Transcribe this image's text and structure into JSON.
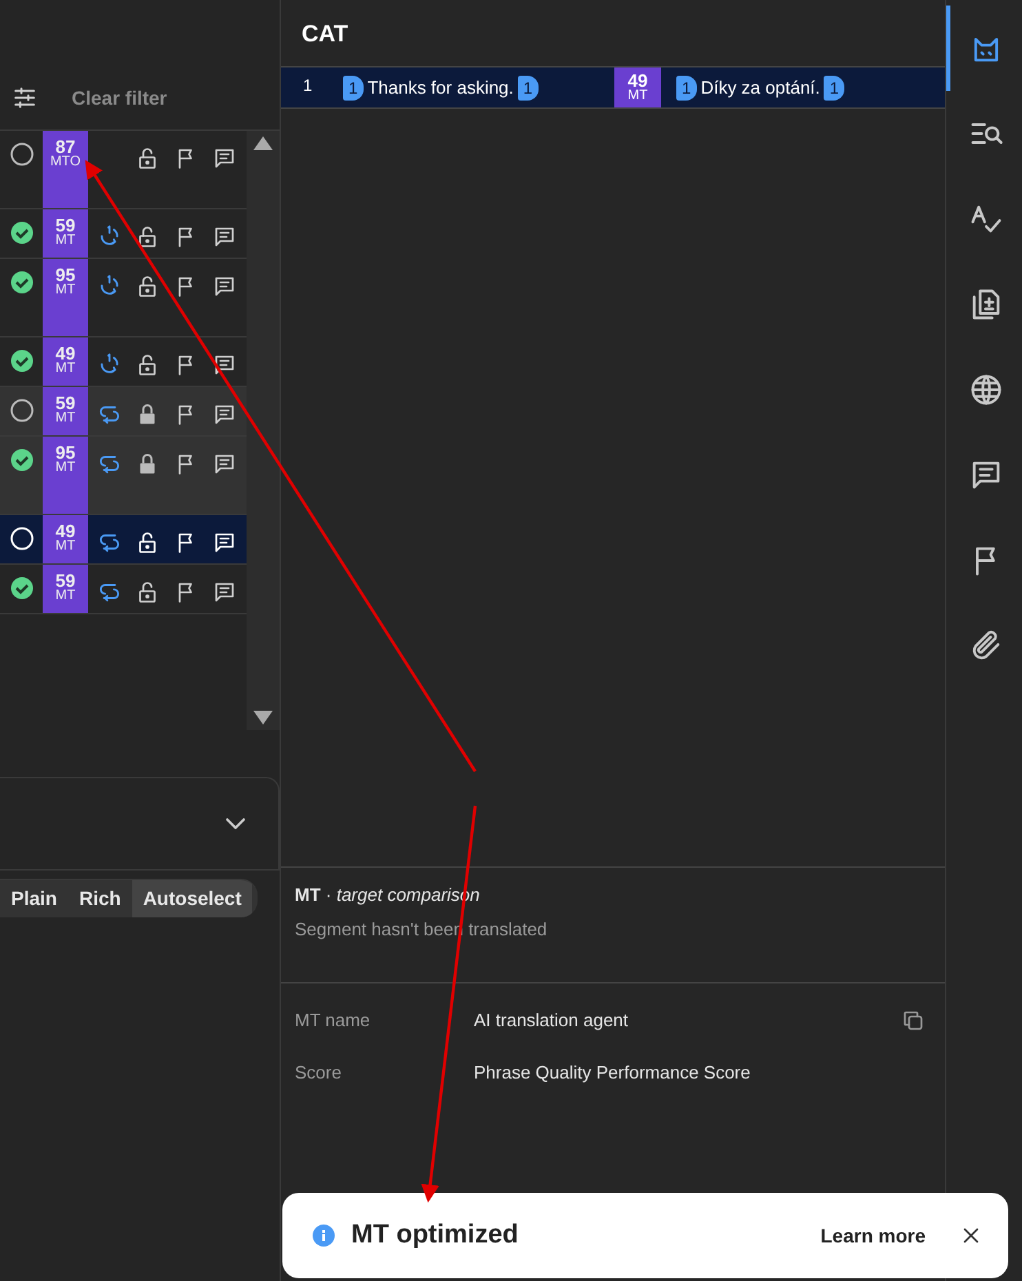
{
  "filter_bar": {
    "clear_label": "Clear filter"
  },
  "segments": [
    {
      "kind": "unique",
      "confirmed": false,
      "score": "87",
      "score_type": "MTO",
      "locked": false,
      "selected": false,
      "tall": true
    },
    {
      "kind": "first",
      "confirmed": true,
      "score": "59",
      "score_type": "MT",
      "locked": false,
      "selected": false,
      "tall": false
    },
    {
      "kind": "first",
      "confirmed": true,
      "score": "95",
      "score_type": "MT",
      "locked": false,
      "selected": false,
      "tall": true
    },
    {
      "kind": "first",
      "confirmed": true,
      "score": "49",
      "score_type": "MT",
      "locked": false,
      "selected": false,
      "tall": false
    },
    {
      "kind": "repeated",
      "confirmed": false,
      "score": "59",
      "score_type": "MT",
      "locked": true,
      "selected": false,
      "tall": false
    },
    {
      "kind": "repeated",
      "confirmed": true,
      "score": "95",
      "score_type": "MT",
      "locked": true,
      "selected": false,
      "tall": true
    },
    {
      "kind": "repeated",
      "confirmed": false,
      "score": "49",
      "score_type": "MT",
      "locked": false,
      "selected": true,
      "tall": false
    },
    {
      "kind": "repeated",
      "confirmed": true,
      "score": "59",
      "score_type": "MT",
      "locked": false,
      "selected": false,
      "tall": false
    }
  ],
  "format_toggle": [
    {
      "label": "Plain",
      "selected": false
    },
    {
      "label": "Rich",
      "selected": false
    },
    {
      "label": "Autoselect",
      "selected": true
    }
  ],
  "cat": {
    "title": "CAT",
    "rows": [
      {
        "number": "1",
        "source": [
          {
            "kind": "tag",
            "text": "1"
          },
          {
            "kind": "text",
            "text": "Thanks for asking."
          },
          {
            "kind": "tag",
            "text": "1"
          }
        ],
        "score": "49",
        "score_type": "MT",
        "target": [
          {
            "kind": "tag",
            "text": "1"
          },
          {
            "kind": "text",
            "text": "Díky za optání."
          },
          {
            "kind": "tag",
            "text": "1"
          }
        ],
        "selected": true
      }
    ]
  },
  "comparison": {
    "heading": "**MT** · *target comparison*",
    "message": "Segment hasn't been translated"
  },
  "details": [
    {
      "label": "MT name",
      "value": "AI translation agent",
      "copyable": true
    },
    {
      "label": "Score",
      "value": "Phrase Quality Performance Score",
      "copyable": false
    }
  ],
  "sidebar": [
    {
      "kind": "cat",
      "selected": true
    },
    {
      "kind": "search",
      "selected": false
    },
    {
      "kind": "spellcheck",
      "selected": false
    },
    {
      "kind": "document",
      "selected": false
    },
    {
      "kind": "globe",
      "selected": false
    },
    {
      "kind": "comment",
      "selected": false
    },
    {
      "kind": "flag",
      "selected": false
    },
    {
      "kind": "paperclip",
      "selected": false
    }
  ],
  "toast": {
    "title": "MT optimized",
    "link": "Learn more"
  },
  "annotations": [
    {
      "kind": "arrow"
    },
    {
      "kind": "arrow"
    }
  ]
}
